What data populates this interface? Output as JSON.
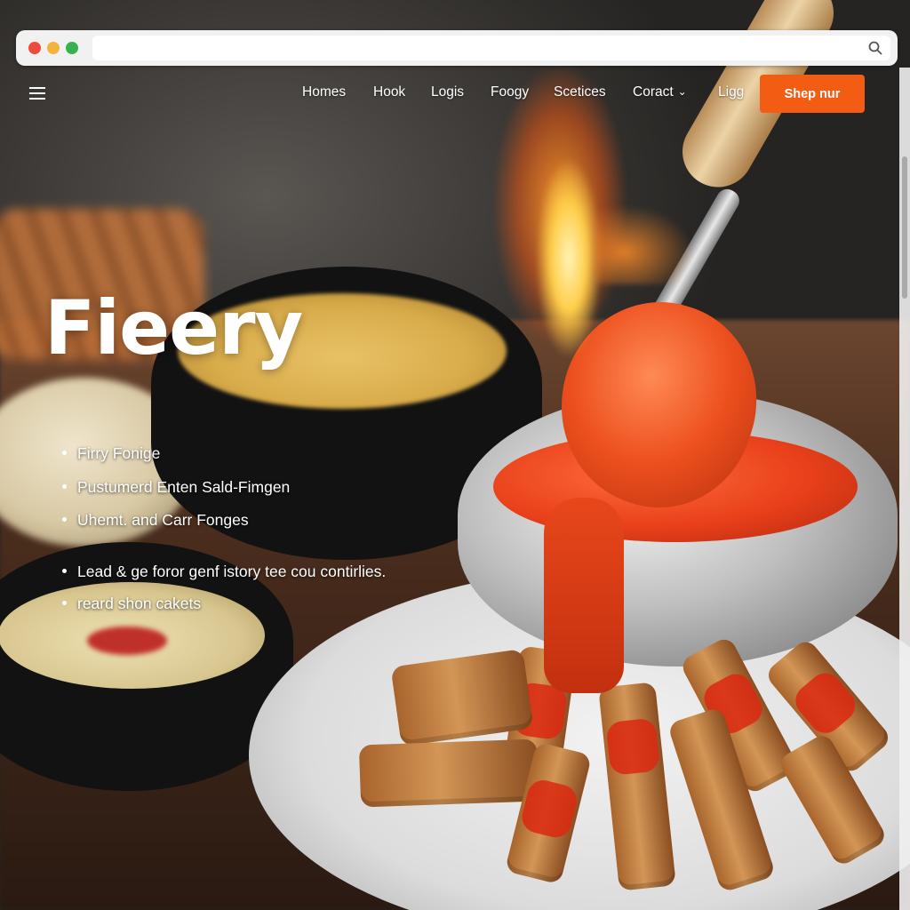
{
  "browser": {
    "window_controls": [
      "close",
      "minimize",
      "maximize"
    ],
    "address_bar_icon": "search-icon"
  },
  "nav": {
    "menu_icon": "hamburger-icon",
    "links": [
      "Homes",
      "Hook",
      "Logis",
      "Foogy",
      "Scetices",
      "Coract",
      "Ligg"
    ],
    "dropdown_link_icon": "chevron-down-icon",
    "cta_label": "Shep nur",
    "cta_color": "#f25c13"
  },
  "hero": {
    "title": "Fieery",
    "bullets": [
      "Firry Fonige",
      "Pustumerd Enten Sald-Fimgen",
      "Uhemt. and Carr Fonges",
      "Lead & ge foror genf istory tee cou contirlies.",
      "reard shon cakets"
    ]
  }
}
